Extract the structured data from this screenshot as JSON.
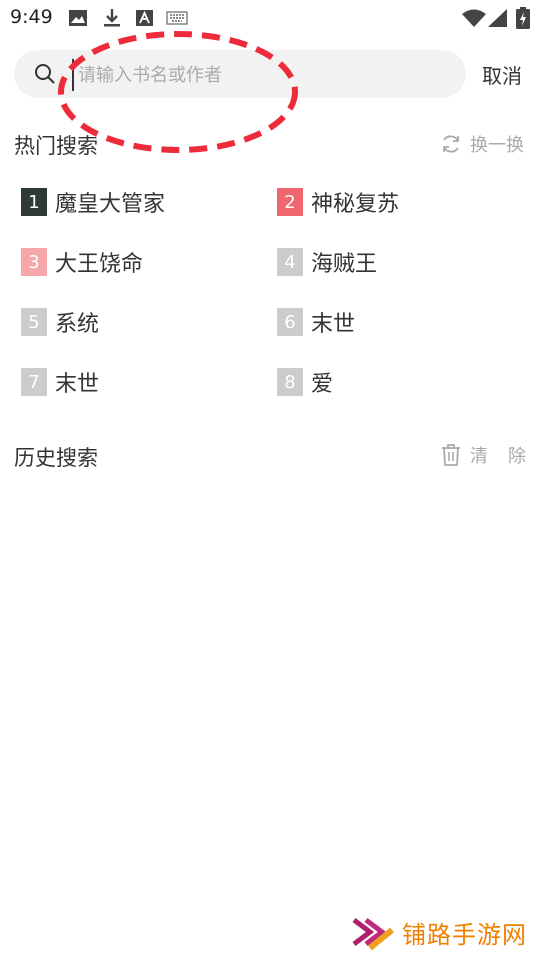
{
  "status_bar": {
    "time": "9:49"
  },
  "search": {
    "placeholder": "请输入书名或作者",
    "cancel_label": "取消"
  },
  "hot": {
    "title": "热门搜索",
    "refresh_label": "换一换",
    "items": [
      {
        "rank": "1",
        "label": "魔皇大管家",
        "color": "#2f3a38"
      },
      {
        "rank": "2",
        "label": "神秘复苏",
        "color": "#f0666e"
      },
      {
        "rank": "3",
        "label": "大王饶命",
        "color": "#f7a6aa"
      },
      {
        "rank": "4",
        "label": "海贼王",
        "color": "#cccccc"
      },
      {
        "rank": "5",
        "label": "系统",
        "color": "#cccccc"
      },
      {
        "rank": "6",
        "label": "末世",
        "color": "#cccccc"
      },
      {
        "rank": "7",
        "label": "末世",
        "color": "#cccccc"
      },
      {
        "rank": "8",
        "label": "爱",
        "color": "#cccccc"
      }
    ]
  },
  "history": {
    "title": "历史搜索",
    "clear_label_1": "清",
    "clear_label_2": "除"
  },
  "watermark": {
    "text": "铺路手游网"
  }
}
